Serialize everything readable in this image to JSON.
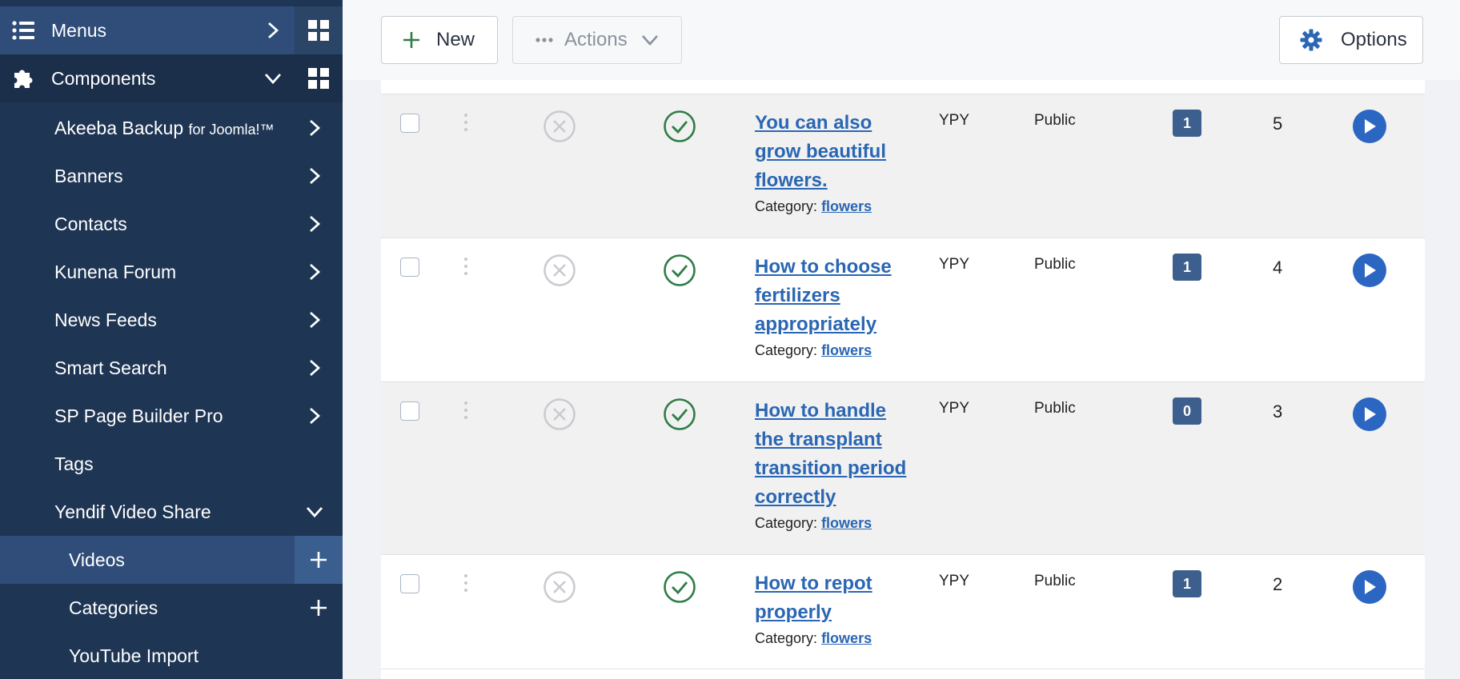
{
  "sidebar": {
    "menus_label": "Menus",
    "components_label": "Components",
    "items": [
      {
        "label": "Akeeba Backup",
        "suffix": "for Joomla!™"
      },
      {
        "label": "Banners"
      },
      {
        "label": "Contacts"
      },
      {
        "label": "Kunena Forum"
      },
      {
        "label": "News Feeds"
      },
      {
        "label": "Smart Search"
      },
      {
        "label": "SP Page Builder Pro"
      },
      {
        "label": "Tags"
      },
      {
        "label": "Yendif Video Share"
      }
    ],
    "subitems": [
      {
        "label": "Videos"
      },
      {
        "label": "Categories"
      },
      {
        "label": "YouTube Import"
      }
    ]
  },
  "toolbar": {
    "new_label": "New",
    "actions_label": "Actions",
    "options_label": "Options"
  },
  "rows": [
    {
      "title": "You can also grow beautiful flowers.",
      "category_label": "Category:",
      "category": "flowers",
      "user": "YPY",
      "access": "Public",
      "badge": "1",
      "id": "5"
    },
    {
      "title": "How to choose fertilizers appropriately",
      "category_label": "Category:",
      "category": "flowers",
      "user": "YPY",
      "access": "Public",
      "badge": "1",
      "id": "4"
    },
    {
      "title": "How to handle the transplant transition period correctly",
      "category_label": "Category:",
      "category": "flowers",
      "user": "YPY",
      "access": "Public",
      "badge": "0",
      "id": "3"
    },
    {
      "title": "How to repot properly",
      "category_label": "Category:",
      "category": "flowers",
      "user": "YPY",
      "access": "Public",
      "badge": "1",
      "id": "2"
    }
  ],
  "colors": {
    "sidebar_bg": "#1e3553",
    "sidebar_active": "#2f4d78",
    "link": "#2a66b3",
    "published_green": "#2e7d46",
    "badge": "#3d5f8e",
    "play": "#2a66c2"
  }
}
